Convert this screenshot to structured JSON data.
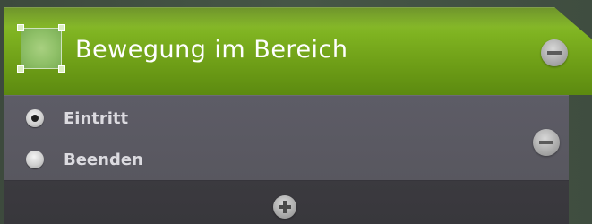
{
  "zone": {
    "title": "Bewegung im Bereich",
    "icon": "zone-area-icon",
    "accent_color": "#7fb321"
  },
  "options": {
    "items": [
      {
        "label": "Eintritt",
        "selected": true
      },
      {
        "label": "Beenden",
        "selected": false
      }
    ]
  },
  "icons": {
    "remove": "minus-circle-icon",
    "add": "plus-circle-icon"
  },
  "colors": {
    "header_green": "#7fb321",
    "panel_gray": "#5b5a63",
    "add_bar": "#39383d"
  }
}
